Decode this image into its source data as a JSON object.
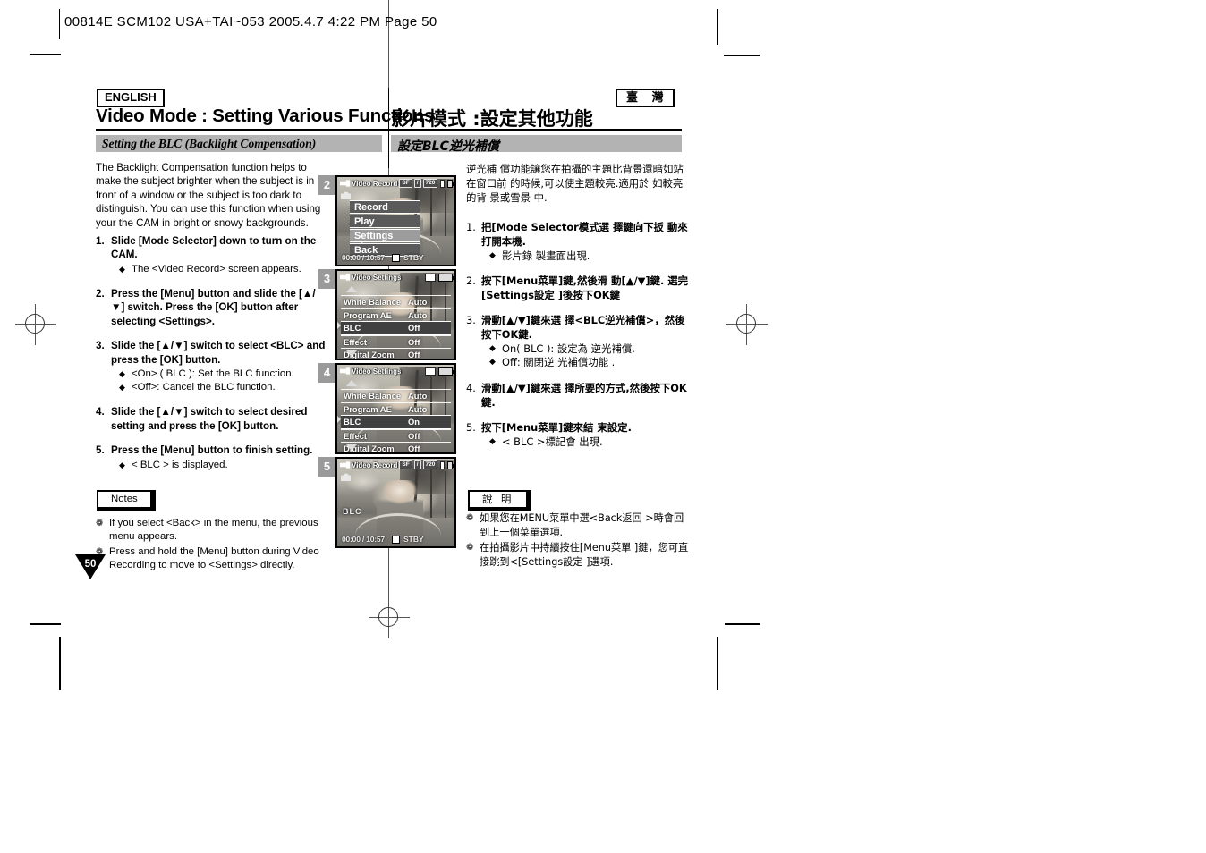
{
  "slug": {
    "text": "00814E SCM102 USA+TAI~053  2005.4.7 4:22 PM  Page 50"
  },
  "header": {
    "english_badge": "ENGLISH",
    "taiwan_badge": "臺 灣",
    "title_en": "Video Mode : Setting Various Functions",
    "title_zh": "影片模式 :設定其他功能"
  },
  "section": {
    "title_en": "Setting the BLC (Backlight Compensation)",
    "title_zh": "設定BLC逆光補償"
  },
  "english": {
    "intro": "The Backlight Compensation function helps to make the subject brighter when the subject is in front of a window or the subject is too dark to distinguish. You can use this function when using your the CAM in bright or snowy backgrounds.",
    "steps": [
      {
        "num": "1.",
        "text": "Slide [Mode Selector] down to turn on the CAM.",
        "bullets": [
          "The <Video Record> screen appears."
        ]
      },
      {
        "num": "2.",
        "text": "Press the [Menu] button and slide the [▲/▼] switch. Press the [OK] button after selecting <Settings>.",
        "bullets": []
      },
      {
        "num": "3.",
        "text": "Slide the [▲/▼] switch to select <BLC> and press the [OK] button.",
        "bullets": [
          "<On> ( BLC ): Set the BLC function.",
          "<Off>: Cancel the BLC function."
        ]
      },
      {
        "num": "4.",
        "text": "Slide the [▲/▼] switch to select desired setting and press the [OK] button.",
        "bullets": []
      },
      {
        "num": "5.",
        "text": "Press the [Menu] button to finish setting.",
        "bullets": [
          "< BLC > is displayed."
        ]
      }
    ],
    "notes_label": "Notes",
    "notes": [
      "If you select <Back> in the menu, the previous menu appears.",
      "Press and hold the [Menu] button during Video Recording to move to <Settings> directly."
    ]
  },
  "chinese": {
    "intro": "逆光補 償功能讓您在拍攝的主題比背景還暗如站在窗口前 的時候,可以使主題較亮.適用於 如較亮的背 景或雪景 中.",
    "steps": [
      {
        "num": "1.",
        "text": "把[Mode Selector模式選 擇鍵向下扳 動來打開本機.",
        "bullets": [
          "影片錄 製畫面出現."
        ]
      },
      {
        "num": "2.",
        "text": "按下[Menu菜單]鍵,然後滑 動[▲/▼]鍵. 選完[Settings設定 ]後按下OK鍵",
        "bullets": []
      },
      {
        "num": "3.",
        "text": "滑動[▲/▼]鍵來選 擇<BLC逆光補償>，然後按下OK鍵.",
        "bullets": [
          "On( BLC ): 設定為 逆光補償.",
          "Off: 關閉逆 光補償功能 ."
        ]
      },
      {
        "num": "4.",
        "text": "滑動[▲/▼]鍵來選 擇所要的方式,然後按下OK鍵.",
        "bullets": []
      },
      {
        "num": "5.",
        "text": "按下[Menu菜單]鍵來結 束設定.",
        "bullets": [
          "< BLC >標記會 出現."
        ]
      }
    ],
    "notes_label": "說 明",
    "notes": [
      "如果您在MENU菜單中選<Back返回 >時會回到上一個菜單選項.",
      "在拍攝影片中持續按住[Menu菜單 ]鍵，您可直接跳到<[Settings設定 ]選項."
    ]
  },
  "screens": [
    {
      "num": "2",
      "type": "menu",
      "osd_title": "Video Record",
      "chips": [
        "SF",
        "/",
        "720"
      ],
      "menu_items": [
        {
          "label": "Record",
          "selected": false
        },
        {
          "label": "Play",
          "selected": false
        },
        {
          "label": "Settings",
          "selected": true
        },
        {
          "label": "Back",
          "selected": false
        }
      ],
      "timecode": "00:00 / 10:57",
      "status": "STBY",
      "blc_indicator": ""
    },
    {
      "num": "3",
      "type": "settings",
      "osd_title": "Video Settings",
      "chips": [],
      "rows": [
        {
          "name": "White Balance",
          "value": "Auto",
          "highlighted": false
        },
        {
          "name": "Program AE",
          "value": "Auto",
          "highlighted": false
        },
        {
          "name": "BLC",
          "value": "Off",
          "highlighted": true
        },
        {
          "name": "Effect",
          "value": "Off",
          "highlighted": false
        },
        {
          "name": "Digital Zoom",
          "value": "Off",
          "highlighted": false
        }
      ]
    },
    {
      "num": "4",
      "type": "settings",
      "osd_title": "Video Settings",
      "chips": [],
      "rows": [
        {
          "name": "White Balance",
          "value": "Auto",
          "highlighted": false
        },
        {
          "name": "Program AE",
          "value": "Auto",
          "highlighted": false
        },
        {
          "name": "BLC",
          "value": "On",
          "highlighted": true
        },
        {
          "name": "Effect",
          "value": "Off",
          "highlighted": false
        },
        {
          "name": "Digital Zoom",
          "value": "Off",
          "highlighted": false
        }
      ]
    },
    {
      "num": "5",
      "type": "record",
      "osd_title": "Video Record",
      "chips": [
        "SF",
        "/",
        "720"
      ],
      "timecode": "00:00 / 10:57",
      "status": "STBY",
      "blc_indicator": "BLC"
    }
  ],
  "page_number": "50"
}
